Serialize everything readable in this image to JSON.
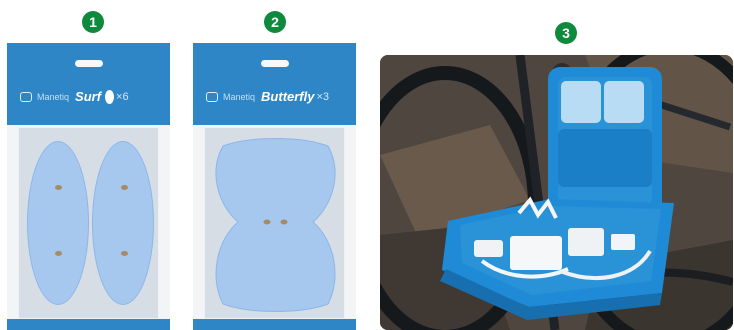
{
  "badges": [
    "1",
    "2",
    "3"
  ],
  "panel_1": {
    "brand": "Manetiq",
    "product": "Surf",
    "count": "×6"
  },
  "panel_2": {
    "brand": "Manetiq",
    "product": "Butterfly",
    "count": "×3"
  },
  "colors": {
    "badge_green": "#0f8a3c",
    "pack_blue": "#2f86c6",
    "pad_blue": "#a7c8ee",
    "case_blue": "#2a93d8"
  },
  "icons": {
    "badge": "numbered-circle-icon",
    "brand_logo": "brand-logo-icon"
  }
}
